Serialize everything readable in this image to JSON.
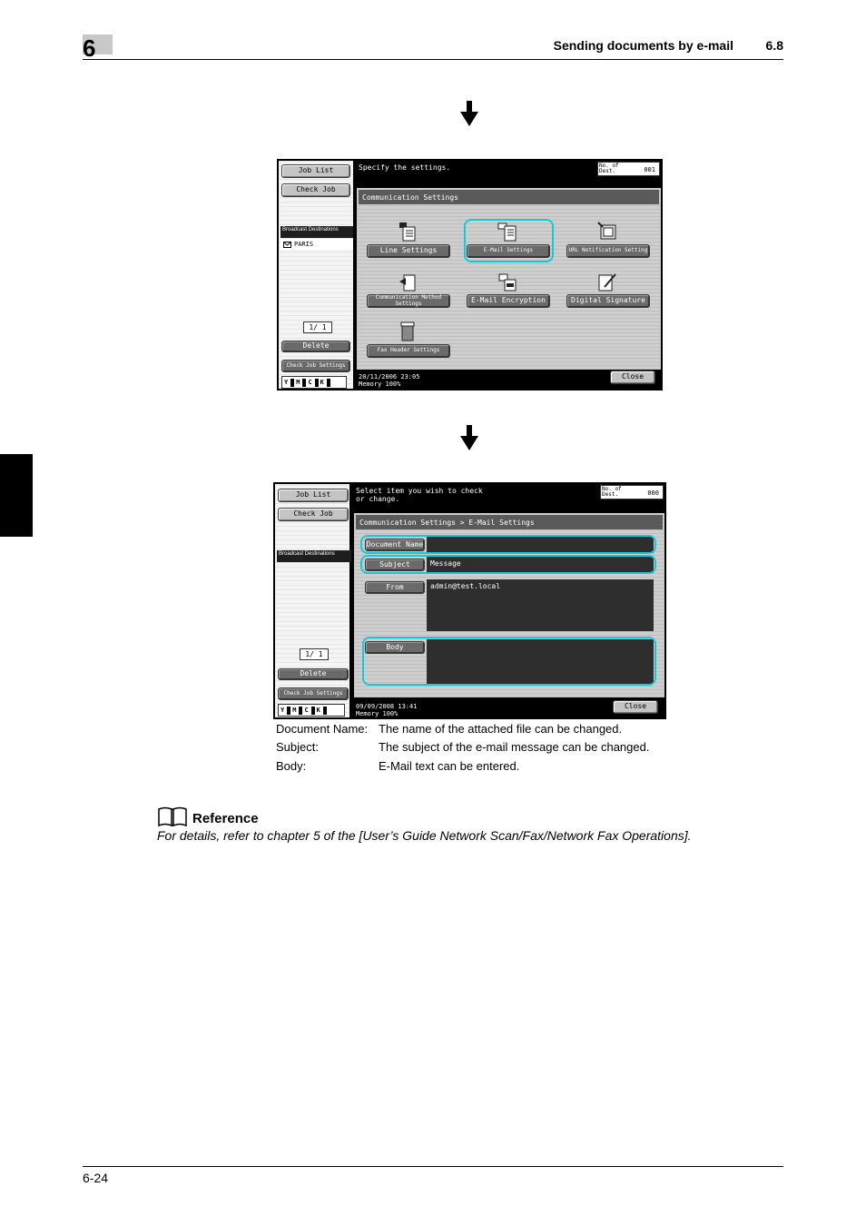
{
  "header": {
    "chapter": "6",
    "title": "Sending documents by e-mail",
    "section": "6.8"
  },
  "screen1": {
    "left": {
      "job_list": "Job List",
      "check_job": "Check Job",
      "broadcast_header": "Broadcast Destinations",
      "destination": "PARIS",
      "page_counter": "1/   1",
      "delete": "Delete",
      "check_job_settings": "Check Job Settings",
      "toner": [
        "Y",
        "M",
        "C",
        "K"
      ]
    },
    "message": "Specify the settings.",
    "no_of_dest_label": "No. of Dest.",
    "no_of_dest_value": "001",
    "title_bar": "Communication Settings",
    "buttons": {
      "line_settings": "Line Settings",
      "email_settings": "E-Mail Settings",
      "url_notification": "URL Notification Setting",
      "comm_method": "Communication Method Settings",
      "email_encryption": "E-Mail Encryption",
      "digital_signature": "Digital Signature",
      "fax_header": "Fax Header Settings"
    },
    "status": "20/11/2006    23:05\nMemory       100%",
    "close": "Close"
  },
  "screen2": {
    "left": {
      "job_list": "Job List",
      "check_job": "Check Job",
      "broadcast_header": "Broadcast Destinations",
      "page_counter": "1/   1",
      "delete": "Delete",
      "check_job_settings": "Check Job Settings",
      "toner": [
        "Y",
        "M",
        "C",
        "K"
      ]
    },
    "message": "Select item you wish to check\nor change.",
    "no_of_dest_label": "No. of Dest.",
    "no_of_dest_value": "000",
    "title_bar": "Communication Settings > E-Mail Settings",
    "fields": {
      "document_name_label": "Document Name",
      "document_name_value": "",
      "subject_label": "Subject",
      "subject_value": "Message",
      "from_label": "From",
      "from_value": "admin@test.local",
      "body_label": "Body",
      "body_value": ""
    },
    "status": "09/09/2008    13:41\nMemory       100%",
    "close": "Close"
  },
  "descriptions": [
    {
      "term": "Document Name:",
      "text": "The name of the attached file can be changed."
    },
    {
      "term": "Subject:",
      "text": "The subject of the e-mail message can be changed."
    },
    {
      "term": "Body:",
      "text": "E-Mail text can be entered."
    }
  ],
  "reference": {
    "title": "Reference",
    "text": "For details, refer to chapter 5 of the [User’s Guide Network Scan/Fax/Network Fax Operations]."
  },
  "footer": {
    "page": "6-24"
  }
}
